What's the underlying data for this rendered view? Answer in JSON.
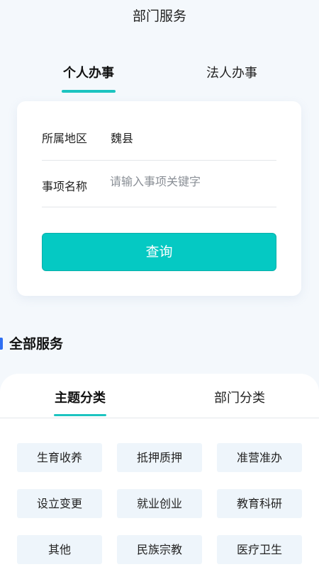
{
  "header": {
    "title": "部门服务"
  },
  "top_tabs": [
    {
      "label": "个人办事",
      "active": true
    },
    {
      "label": "法人办事",
      "active": false
    }
  ],
  "form": {
    "region_label": "所属地区",
    "region_value": "魏县",
    "item_label": "事项名称",
    "item_placeholder": "请输入事项关键字",
    "item_value": "",
    "query_button": "查询"
  },
  "all_services": {
    "title": "全部服务",
    "tabs": [
      {
        "label": "主题分类",
        "active": true
      },
      {
        "label": "部门分类",
        "active": false
      }
    ],
    "items": [
      "生育收养",
      "抵押质押",
      "准营准办",
      "设立变更",
      "就业创业",
      "教育科研",
      "其他",
      "民族宗教",
      "医疗卫生"
    ]
  },
  "colors": {
    "accent": "#05c9c3",
    "tab_underline": "#1cc4c0",
    "section_bar": "#2f6ff2",
    "page_bg": "#f4f8fc",
    "chip_bg": "#eef5fb"
  }
}
